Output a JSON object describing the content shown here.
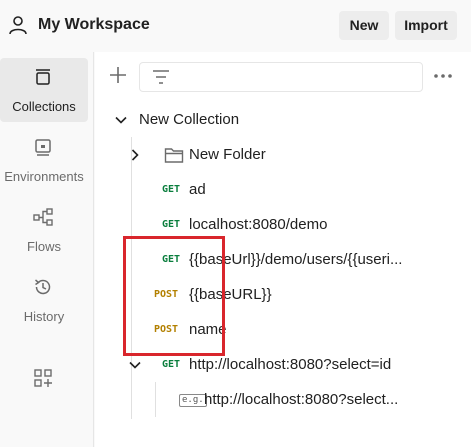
{
  "header": {
    "workspace_title": "My Workspace",
    "new_label": "New",
    "import_label": "Import",
    "user_icon": "user-icon"
  },
  "sidebar": {
    "items": [
      {
        "label": "Collections",
        "icon": "collections-icon",
        "active": true
      },
      {
        "label": "Environments",
        "icon": "environments-icon",
        "active": false
      },
      {
        "label": "Flows",
        "icon": "flows-icon",
        "active": false
      },
      {
        "label": "History",
        "icon": "history-icon",
        "active": false
      },
      {
        "label": "",
        "icon": "add-apps-icon",
        "active": false
      }
    ]
  },
  "toolbar": {
    "add_icon": "plus-icon",
    "filter_icon": "filter-icon",
    "more_icon": "more-options-icon"
  },
  "tree": {
    "collection": "New Collection",
    "folder": "New Folder",
    "requests": [
      {
        "method": "GET",
        "name": "ad"
      },
      {
        "method": "GET",
        "name": "localhost:8080/demo"
      },
      {
        "method": "GET",
        "name": "{{baseUrl}}/demo/users/{{useri..."
      },
      {
        "method": "POST",
        "name": "{{baseURL}}"
      },
      {
        "method": "POST",
        "name": "name"
      },
      {
        "method": "GET",
        "name": "http://localhost:8080?select=id"
      }
    ],
    "example": {
      "badge": "e.g.",
      "name": "http://localhost:8080?select..."
    }
  },
  "colors": {
    "get": "#0a7e3d",
    "post": "#b38000",
    "highlight": "#d9262c"
  }
}
